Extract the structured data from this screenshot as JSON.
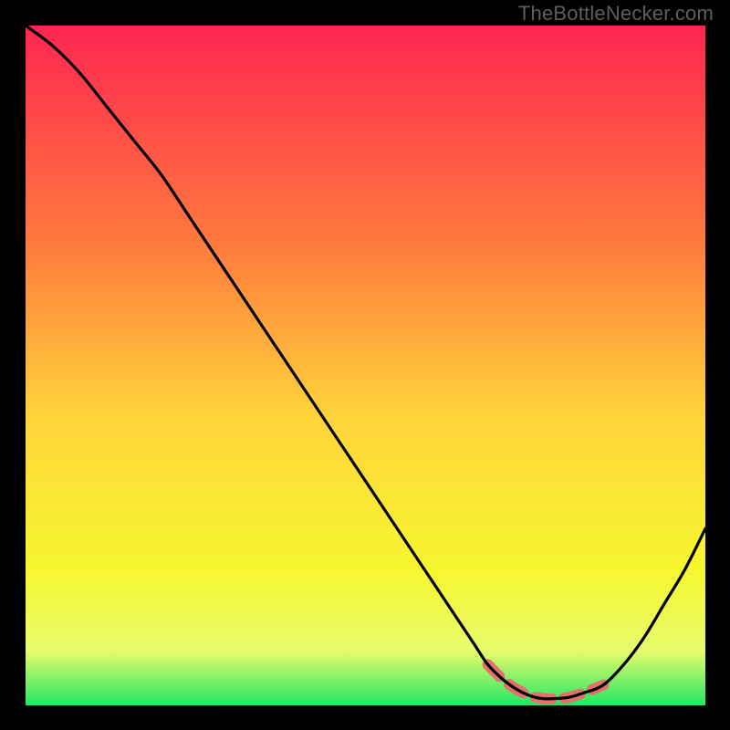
{
  "watermark": "TheBottleNecker.com",
  "colors": {
    "bg": "#000000",
    "grad_top": "#ff2651",
    "grad_mid_upper": "#ff7a3e",
    "grad_mid": "#ffd53a",
    "grad_mid_lower": "#f6f62f",
    "grad_low": "#e8fb6c",
    "grad_bottom": "#22e765",
    "curve": "#000000",
    "highlight": "#e4716b"
  },
  "chart_data": {
    "type": "line",
    "title": "",
    "xlabel": "",
    "ylabel": "",
    "xlim": [
      0,
      100
    ],
    "ylim": [
      0,
      100
    ],
    "x": [
      0,
      4,
      8,
      12,
      16,
      20,
      24,
      28,
      32,
      36,
      40,
      44,
      48,
      52,
      56,
      60,
      64,
      66,
      68,
      70,
      72,
      74,
      76,
      78,
      80,
      82,
      85,
      88,
      91,
      94,
      97,
      100
    ],
    "values": [
      100,
      97,
      93,
      88,
      83,
      78,
      72,
      66,
      60,
      54,
      48,
      42,
      36,
      30,
      24,
      18,
      12,
      9,
      6,
      4,
      2.5,
      1.5,
      1,
      1,
      1.2,
      1.8,
      3,
      6,
      10,
      15,
      20,
      26
    ],
    "highlight_segment": {
      "x_start": 68,
      "x_end": 86
    },
    "annotations": []
  }
}
